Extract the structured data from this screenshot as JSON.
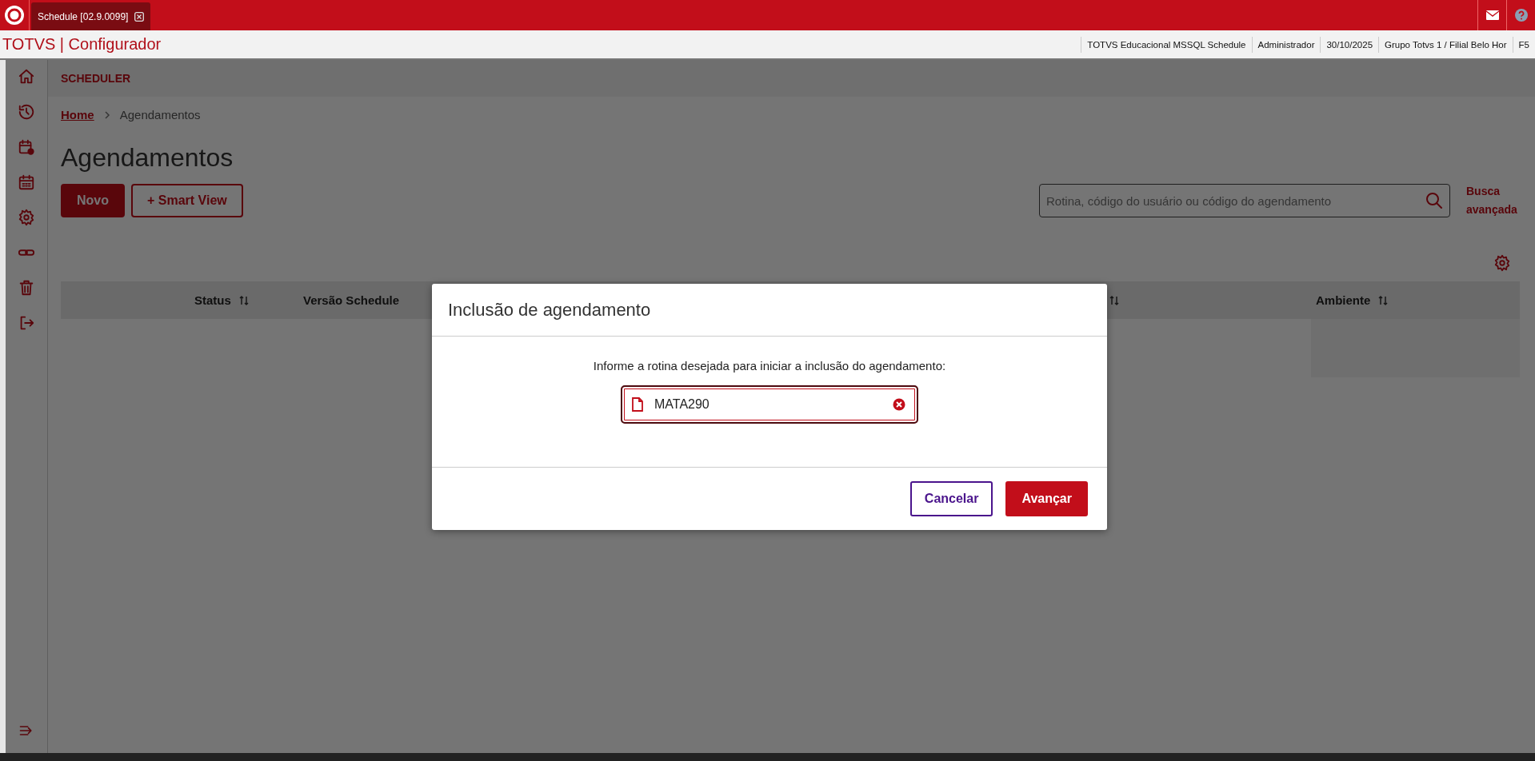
{
  "top_bar": {
    "tabs": [
      {
        "label": "Schedule [02.9.0099]",
        "selected": true
      }
    ]
  },
  "header": {
    "title": "TOTVS | Configurador",
    "info": [
      "TOTVS Educacional MSSQL Schedule",
      "Administrador",
      "30/10/2025",
      "Grupo Totvs 1 / Filial Belo Hor",
      "F5"
    ]
  },
  "page": {
    "section": "SCHEDULER",
    "breadcrumb": [
      {
        "label": "Home",
        "kind": "link"
      },
      {
        "label": "Agendamentos",
        "kind": "current"
      }
    ],
    "title": "Agendamentos",
    "buttons": [
      {
        "label": "Novo",
        "kind": "primary"
      },
      {
        "label": "+ Smart View",
        "kind": "secondary"
      }
    ],
    "search": {
      "placeholder": "Rotina, código do usuário ou código do agendamento"
    },
    "advanced_search": "Busca avançada"
  },
  "table": {
    "columns": [
      {
        "label": "Status",
        "sortable": true
      },
      {
        "label": "Versão Schedule",
        "sortable": false
      },
      {
        "sortable": true
      },
      {
        "label": "Ambiente",
        "sortable": true
      }
    ]
  },
  "dialog": {
    "title": "Inclusão de agendamento",
    "prompt": "Informe a rotina desejada para iniciar a inclusão do agendamento:",
    "field": {
      "value": "MATA290"
    },
    "buttons": [
      {
        "label": "Cancelar",
        "kind": "secondary"
      },
      {
        "label": "Avançar",
        "kind": "primary"
      }
    ]
  }
}
